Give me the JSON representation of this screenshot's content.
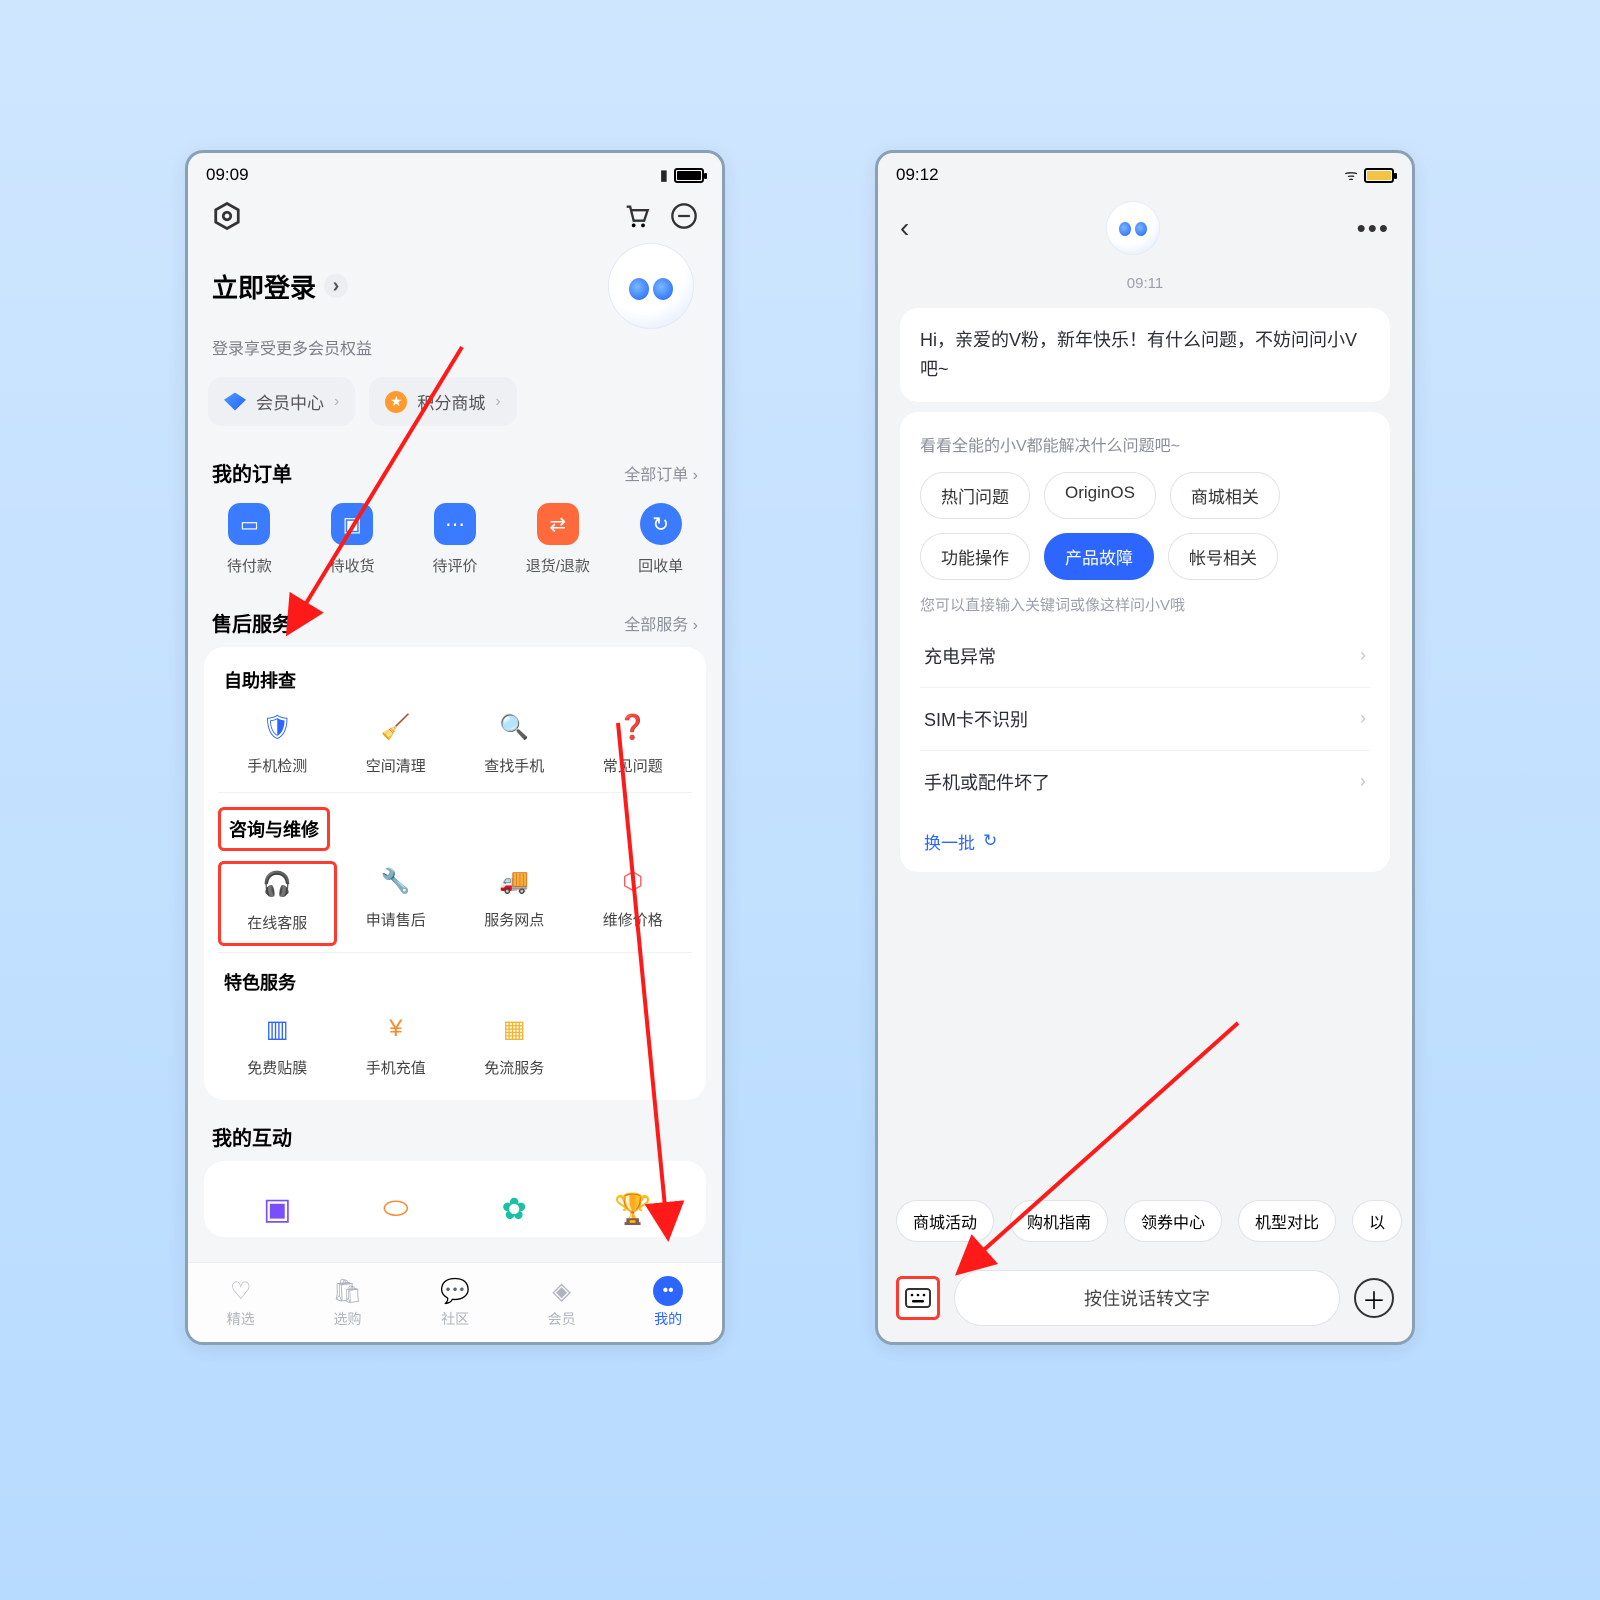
{
  "left": {
    "time": "09:09",
    "header": {
      "cart": "cart-icon",
      "chat": "chat-icon"
    },
    "login": {
      "title": "立即登录",
      "subtitle": "登录享受更多会员权益"
    },
    "chips": {
      "member": "会员中心",
      "points": "积分商城"
    },
    "orders": {
      "title": "我的订单",
      "more": "全部订单",
      "items": [
        {
          "label": "待付款"
        },
        {
          "label": "待收货"
        },
        {
          "label": "待评价"
        },
        {
          "label": "退货/退款"
        },
        {
          "label": "回收单"
        }
      ]
    },
    "after": {
      "title": "售后服务",
      "more": "全部服务",
      "sec1_title": "自助排查",
      "sec1": [
        {
          "label": "手机检测"
        },
        {
          "label": "空间清理"
        },
        {
          "label": "查找手机"
        },
        {
          "label": "常见问题"
        }
      ],
      "sec2_title": "咨询与维修",
      "sec2": [
        {
          "label": "在线客服"
        },
        {
          "label": "申请售后"
        },
        {
          "label": "服务网点"
        },
        {
          "label": "维修价格"
        }
      ],
      "sec3_title": "特色服务",
      "sec3": [
        {
          "label": "免费贴膜"
        },
        {
          "label": "手机充值"
        },
        {
          "label": "免流服务"
        }
      ]
    },
    "interaction_title": "我的互动",
    "tabs": [
      {
        "label": "精选"
      },
      {
        "label": "选购"
      },
      {
        "label": "社区"
      },
      {
        "label": "会员"
      },
      {
        "label": "我的"
      }
    ]
  },
  "right": {
    "time": "09:12",
    "chat_time": "09:11",
    "greeting": "Hi，亲爱的V粉，新年快乐！有什么问题，不妨问问小V吧~",
    "card": {
      "hint1": "看看全能的小V都能解决什么问题吧~",
      "pills": [
        "热门问题",
        "OriginOS",
        "商城相关",
        "功能操作",
        "产品故障",
        "帐号相关"
      ],
      "active_pill": 4,
      "hint2": "您可以直接输入关键词或像这样问小V哦",
      "links": [
        "充电异常",
        "SIM卡不识别",
        "手机或配件坏了"
      ],
      "refresh": "换一批"
    },
    "suggestions": [
      "商城活动",
      "购机指南",
      "领券中心",
      "机型对比",
      "以"
    ],
    "voice_placeholder": "按住说话转文字"
  }
}
